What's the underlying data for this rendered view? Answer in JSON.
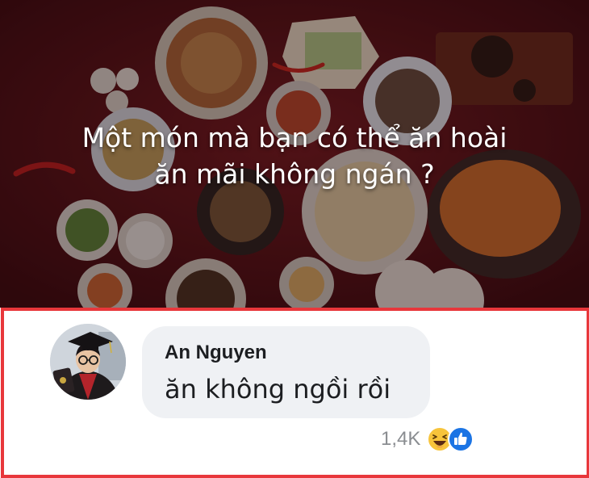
{
  "post": {
    "headline_line1": "Một món mà bạn có thể ăn hoài",
    "headline_line2": "ăn mãi không ngán ?",
    "background_color": "#5a1218"
  },
  "comment": {
    "author": "An Nguyen",
    "text": "ăn không ngồi rồi",
    "reaction_count": "1,4K",
    "reactions": [
      "haha-icon",
      "like-icon"
    ],
    "highlight_color": "#e8373b"
  }
}
